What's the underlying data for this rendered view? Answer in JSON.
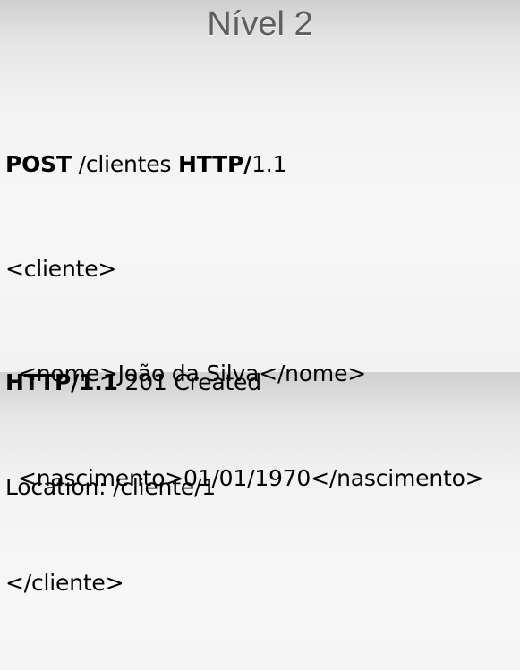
{
  "slide": {
    "title": "Nível 2"
  },
  "request": {
    "method": "POST",
    "path": " /clientes ",
    "protocol": "HTTP/",
    "version": "1.1",
    "body_open": "<cliente>",
    "nome_line": "<nome>João da Silva</nome>",
    "nascimento_line": "<nascimento>01/01/1970</nascimento>",
    "body_close": "</cliente>"
  },
  "response": {
    "protocol": "HTTP/1.1",
    "status": " 201 Created",
    "location": "Location: /cliente/1"
  }
}
